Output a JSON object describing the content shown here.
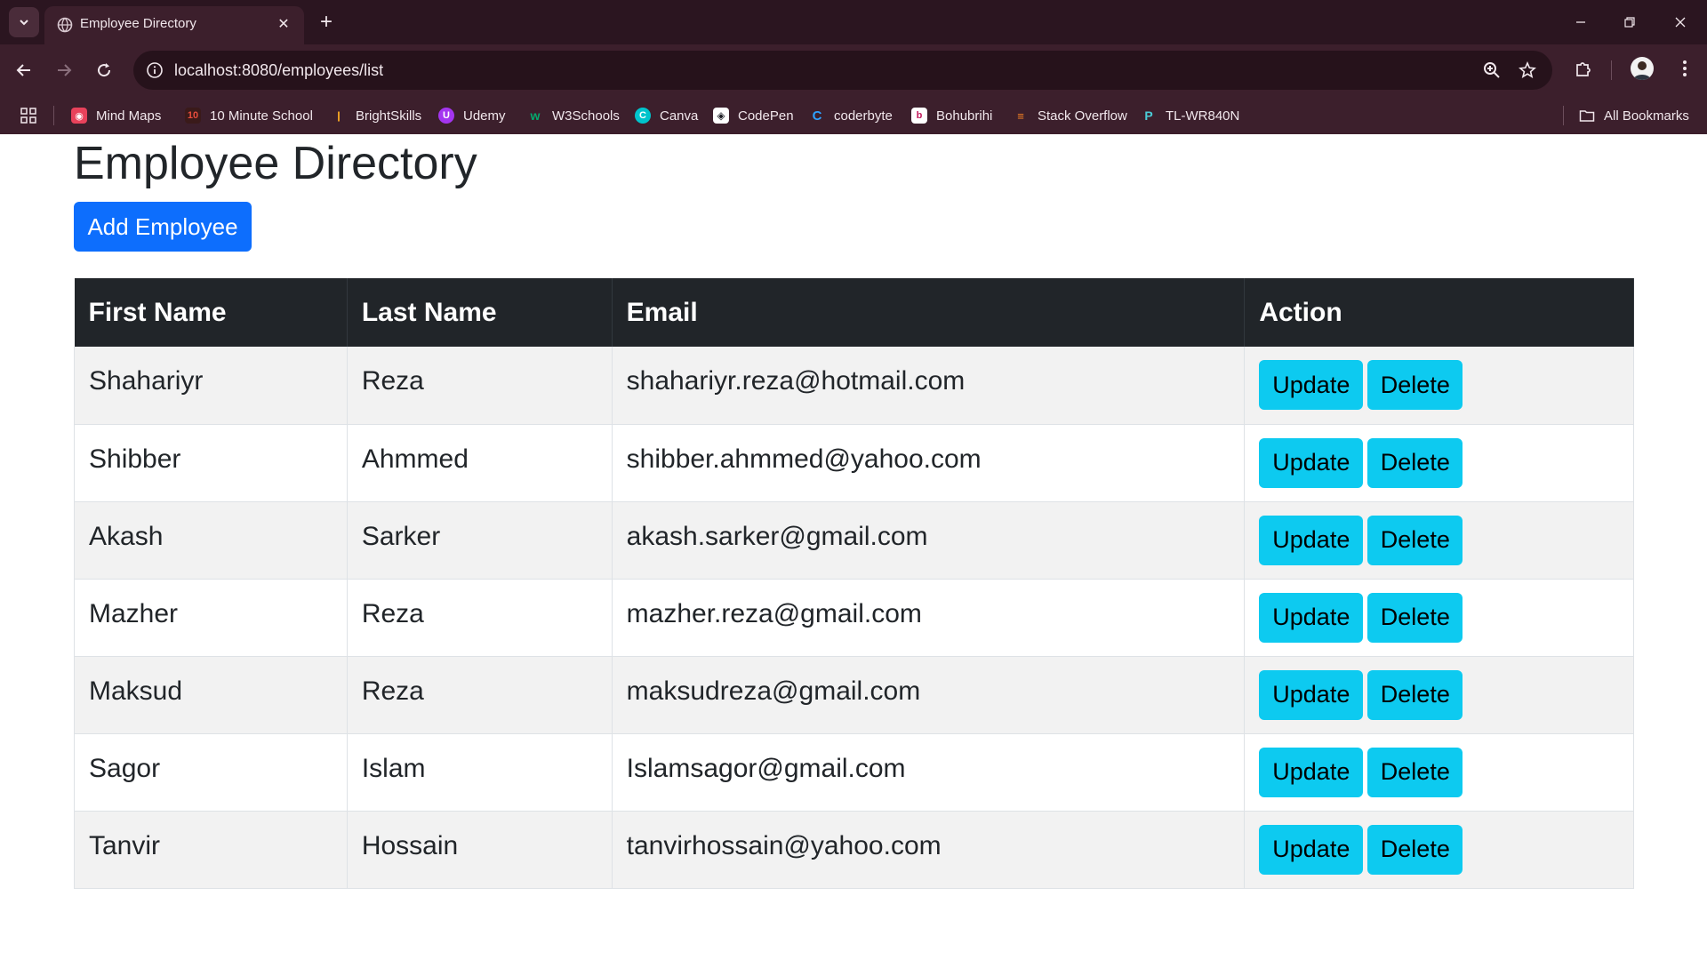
{
  "browser": {
    "tab_title": "Employee Directory",
    "url": "localhost:8080/employees/list",
    "bookmarks": [
      {
        "label": "Mind Maps",
        "icon": "mindmaps-icon",
        "color": "#e8425b"
      },
      {
        "label": "10 Minute School",
        "icon": "10-minute-school-icon",
        "color": "#c0392b"
      },
      {
        "label": "BrightSkills",
        "icon": "brightskills-icon",
        "color": "#f5a623"
      },
      {
        "label": "Udemy",
        "icon": "udemy-icon",
        "color": "#a435f0"
      },
      {
        "label": "W3Schools",
        "icon": "w3schools-icon",
        "color": "#04aa6d"
      },
      {
        "label": "Canva",
        "icon": "canva-icon",
        "color": "#00c4cc"
      },
      {
        "label": "CodePen",
        "icon": "codepen-icon",
        "color": "#1e1f26"
      },
      {
        "label": "coderbyte",
        "icon": "coderbyte-icon",
        "color": "#2ea0ff"
      },
      {
        "label": "Bohubrihi",
        "icon": "bohubrihi-icon",
        "color": "#c2185b"
      },
      {
        "label": "Stack Overflow",
        "icon": "stack-overflow-icon",
        "color": "#f48024"
      },
      {
        "label": "TL-WR840N",
        "icon": "tp-link-icon",
        "color": "#4acbd6"
      }
    ],
    "all_bookmarks_label": "All Bookmarks"
  },
  "page": {
    "title": "Employee Directory",
    "add_button_label": "Add Employee"
  },
  "table": {
    "headers": {
      "first_name": "First Name",
      "last_name": "Last Name",
      "email": "Email",
      "action": "Action"
    },
    "update_label": "Update",
    "delete_label": "Delete",
    "rows": [
      {
        "first": "Shahariyr",
        "last": "Reza",
        "email": "shahariyr.reza@hotmail.com"
      },
      {
        "first": "Shibber",
        "last": "Ahmmed",
        "email": "shibber.ahmmed@yahoo.com"
      },
      {
        "first": "Akash",
        "last": "Sarker",
        "email": "akash.sarker@gmail.com"
      },
      {
        "first": "Mazher",
        "last": "Reza",
        "email": "mazher.reza@gmail.com"
      },
      {
        "first": "Maksud",
        "last": "Reza",
        "email": "maksudreza@gmail.com"
      },
      {
        "first": "Sagor",
        "last": "Islam",
        "email": "Islamsagor@gmail.com"
      },
      {
        "first": "Tanvir",
        "last": "Hossain",
        "email": "tanvirhossain@yahoo.com"
      }
    ]
  },
  "colors": {
    "chrome_bg": "#3c1f2c",
    "primary_button": "#0d6efd",
    "info_button": "#0dcaf0",
    "table_header": "#212529"
  }
}
